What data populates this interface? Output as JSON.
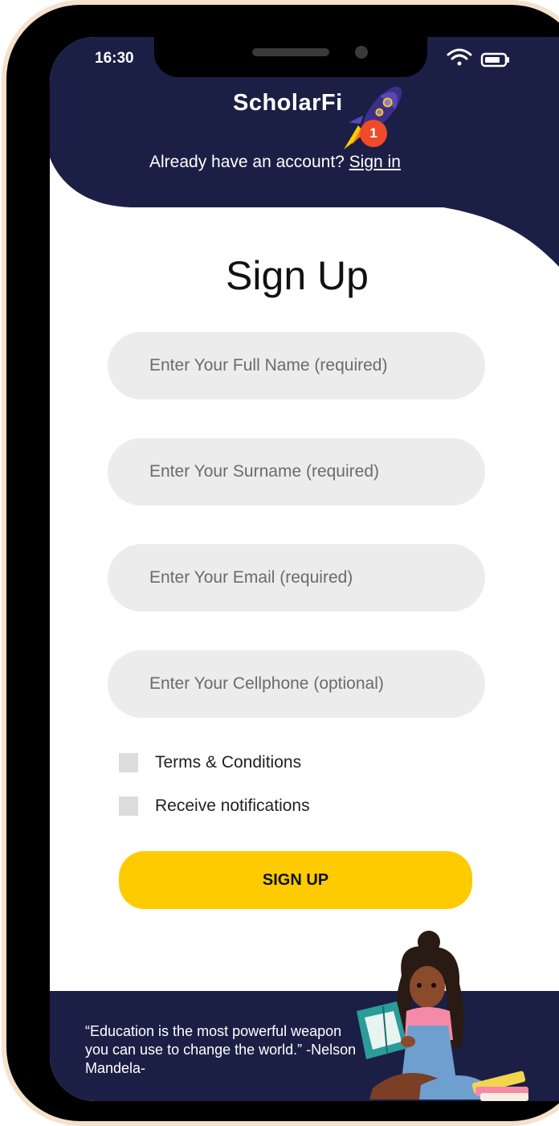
{
  "status_bar": {
    "time": "16:30"
  },
  "header": {
    "brand": "ScholarFi",
    "badge_count": "1",
    "already_text": "Already have an account? ",
    "sign_in_link": "Sign in"
  },
  "form": {
    "title": "Sign Up",
    "fields": [
      {
        "placeholder": "Enter Your Full Name (required)"
      },
      {
        "placeholder": "Enter Your Surname (required)"
      },
      {
        "placeholder": "Enter Your Email (required)"
      },
      {
        "placeholder": "Enter Your Cellphone (optional)"
      }
    ],
    "checkboxes": [
      {
        "label": "Terms & Conditions",
        "checked": false
      },
      {
        "label": "Receive notifications",
        "checked": false
      }
    ],
    "submit_label": "SIGN UP"
  },
  "footer": {
    "quote": "“Education is the most powerful weapon you can use to change the world.”  -Nelson Mandela-"
  },
  "colors": {
    "navy": "#1c1f45",
    "accent_yellow": "#fecb00",
    "badge_red": "#ef4a2a",
    "input_bg": "#ececec",
    "frame_outline": "#f6e1cc"
  },
  "icons": [
    "wifi-icon",
    "battery-icon",
    "rocket-icon",
    "girl-reading-illustration"
  ]
}
